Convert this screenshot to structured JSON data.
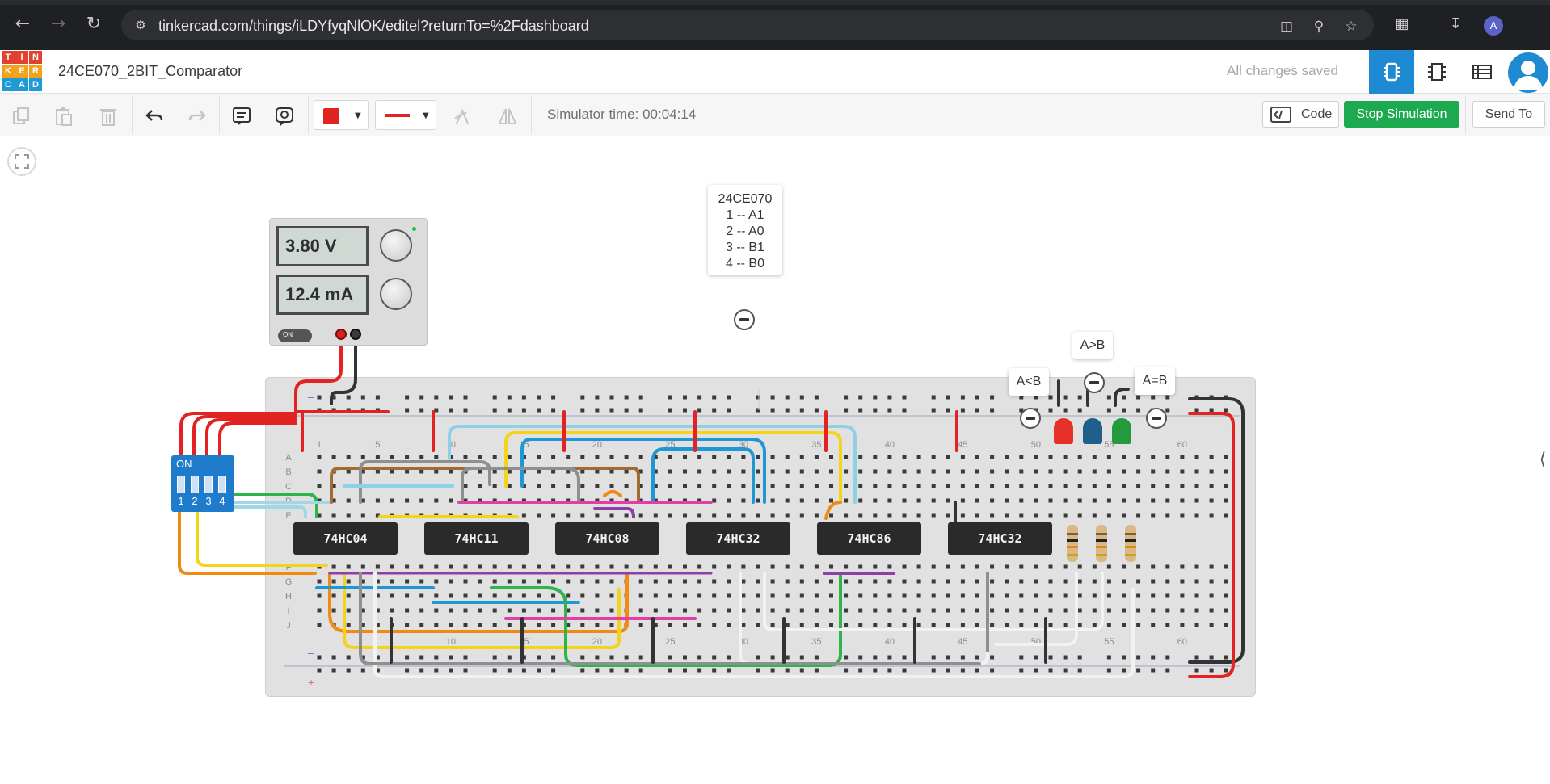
{
  "browser": {
    "url": "tinkercad.com/things/iLDYfyqNlOK/editel?returnTo=%2Fdashboard",
    "profile_initial": "A",
    "icons": [
      "back-icon",
      "forward-icon",
      "reload-icon",
      "site-info-icon",
      "install-icon",
      "zoom-icon",
      "star-icon",
      "extensions-icon",
      "download-icon"
    ]
  },
  "app": {
    "logo_letters": [
      "T",
      "I",
      "N",
      "K",
      "E",
      "R",
      "C",
      "A",
      "D"
    ],
    "logo_colors": [
      "#e2412f",
      "#e2412f",
      "#e2412f",
      "#f3a21b",
      "#f3a21b",
      "#f3a21b",
      "#1e9bd7",
      "#1e9bd7",
      "#1e9bd7"
    ],
    "title": "24CE070_2BIT_Comparator",
    "save_status": "All changes saved",
    "accent_color": "#1d8ad1"
  },
  "toolbar": {
    "simulator_time": "Simulator time: 00:04:14",
    "code_label": "Code",
    "stop_label": "Stop Simulation",
    "send_label": "Send To",
    "wire_color": "#e32222",
    "stop_color": "#1da94f"
  },
  "canvas": {
    "note_lines": [
      "24CE070",
      "1 -- A1",
      "2 -- A0",
      "3 -- B1",
      "4 -- B0"
    ],
    "power_supply": {
      "voltage": "3.80 V",
      "current": "12.4 mA",
      "switch_label": "ON"
    },
    "chips": [
      "74HC04",
      "74HC11",
      "74HC08",
      "74HC32",
      "74HC86",
      "74HC32"
    ],
    "dip_switch": {
      "label": "ON",
      "positions": [
        "1",
        "2",
        "3",
        "4"
      ]
    },
    "led_labels": {
      "less": "A<B",
      "greater": "A>B",
      "equal": "A=B"
    },
    "led_colors": [
      "#e8302a",
      "#1f5f8b",
      "#239a3b"
    ],
    "breadboard": {
      "top_numbers": [
        "1",
        "5",
        "10",
        "15",
        "20",
        "25",
        "30",
        "35",
        "40",
        "45",
        "50",
        "55",
        "60"
      ],
      "bottom_numbers": [
        "10",
        "15",
        "20",
        "25",
        "30",
        "35",
        "40",
        "45",
        "50",
        "55",
        "60"
      ],
      "rows_upper": [
        "A",
        "B",
        "C",
        "D",
        "E"
      ],
      "rows_lower": [
        "F",
        "G",
        "H",
        "I",
        "J"
      ]
    }
  }
}
